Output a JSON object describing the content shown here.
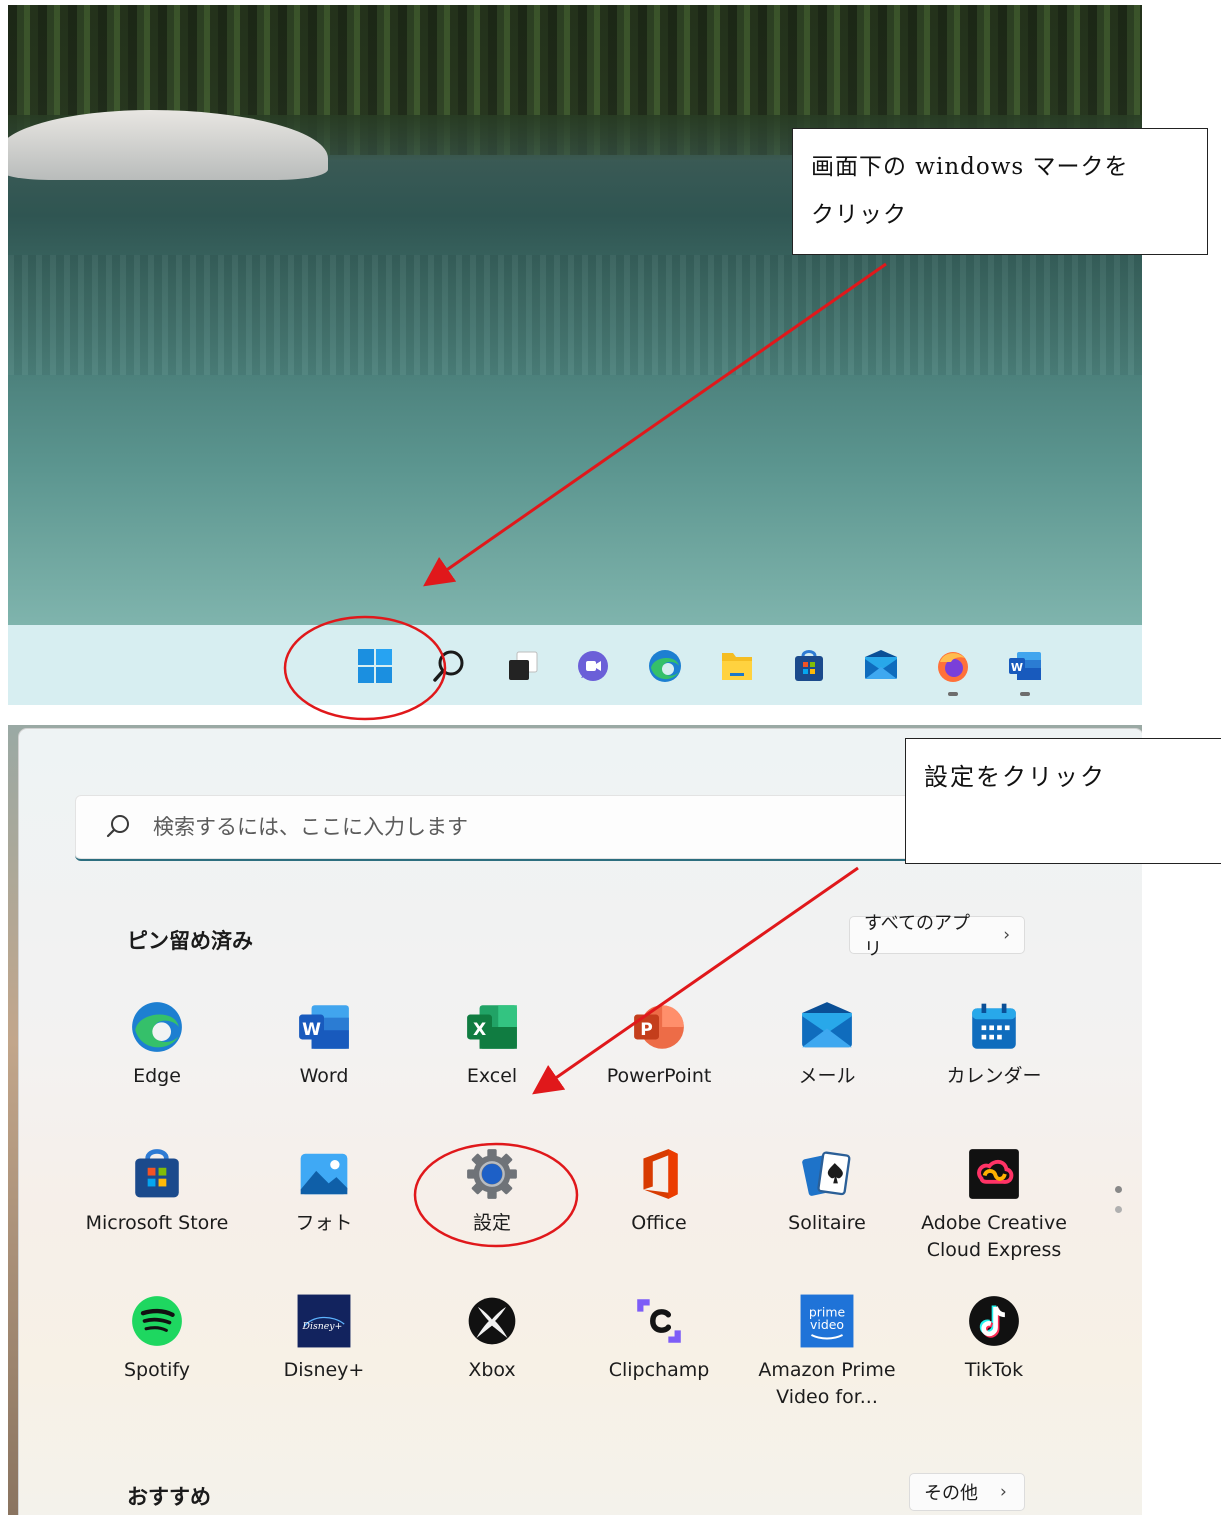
{
  "annotations": {
    "step1_text_line1": "画面下の windows マークを",
    "step1_text_line2": "クリック",
    "step2_text": "設定をクリック"
  },
  "taskbar": {
    "icons": [
      "windows-start-icon",
      "search-icon",
      "task-view-icon",
      "chat-icon",
      "edge-icon",
      "file-explorer-icon",
      "microsoft-store-icon",
      "mail-icon",
      "firefox-icon",
      "word-icon"
    ]
  },
  "start_menu": {
    "search": {
      "placeholder": "検索するには、ここに入力します"
    },
    "pinned": {
      "title": "ピン留め済み",
      "all_apps_label": "すべてのアプリ",
      "chevron": "›",
      "apps": [
        {
          "label": "Edge"
        },
        {
          "label": "Word"
        },
        {
          "label": "Excel"
        },
        {
          "label": "PowerPoint"
        },
        {
          "label": "メール"
        },
        {
          "label": "カレンダー"
        },
        {
          "label": "Microsoft Store"
        },
        {
          "label": "フォト"
        },
        {
          "label": "設定"
        },
        {
          "label": "Office"
        },
        {
          "label": "Solitaire"
        },
        {
          "label": "Adobe Creative Cloud Express"
        },
        {
          "label": "Spotify"
        },
        {
          "label": "Disney+"
        },
        {
          "label": "Xbox"
        },
        {
          "label": "Clipchamp"
        },
        {
          "label": "Amazon Prime Video for..."
        },
        {
          "label": "TikTok"
        }
      ]
    },
    "recommended": {
      "title": "おすすめ",
      "more_label": "その他",
      "chevron": "›"
    }
  },
  "colors": {
    "annotation_red": "#e0181b",
    "windows_blue": "#1e8fe1",
    "search_underline": "#2c6e7f"
  }
}
